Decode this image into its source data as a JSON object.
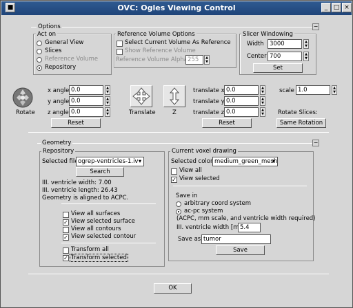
{
  "window": {
    "title": "OVC: Ogles Viewing Control"
  },
  "options": {
    "legend": "Options",
    "act_on": {
      "label": "Act on",
      "items": [
        "General View",
        "Slices",
        "Reference Volume",
        "Repository"
      ],
      "selected": "Repository"
    },
    "reference": {
      "legend": "Reference Volume Options",
      "select_current": "Select Current Volume As Reference",
      "show_reference": "Show Reference Volume",
      "alpha_label": "Reference Volume Alpha",
      "alpha_value": "255"
    },
    "slicer": {
      "legend": "Slicer Windowing",
      "width_label": "Width",
      "width_value": "3000",
      "center_label": "Center",
      "center_value": "700",
      "set_button": "Set"
    }
  },
  "transform": {
    "rotate_label": "Rotate",
    "x_angle_label": "x angle",
    "x_angle": "0.0",
    "y_angle_label": "y angle",
    "y_angle": "0.0",
    "z_angle_label": "z angle",
    "z_angle": "0.0",
    "reset_rotate": "Reset",
    "translate_label": "Translate",
    "z_label": "Z",
    "translate_x_label": "translate x",
    "translate_x": "0.0",
    "translate_y_label": "translate y",
    "translate_y": "0.0",
    "translate_z_label": "translate z",
    "translate_z": "0.0",
    "reset_translate": "Reset",
    "scale_label": "scale",
    "scale_value": "1.0",
    "rotate_slices_label": "Rotate Slices:",
    "same_rotation": "Same Rotation"
  },
  "geometry": {
    "legend": "Geometry",
    "repository": {
      "legend": "Repository",
      "selected_file_label": "Selected file",
      "selected_file": "ogrep-ventricles-1.iv",
      "search_button": "Search",
      "ventricle_width": "III. ventricle width:  7.00",
      "ventricle_length": "III. ventricle length: 26.43",
      "aligned": "Geometry is aligned to ACPC.",
      "checks": [
        {
          "label": "View all surfaces",
          "checked": false
        },
        {
          "label": "View selected surface",
          "checked": true
        },
        {
          "label": "View all contours",
          "checked": false
        },
        {
          "label": "View selected contour",
          "checked": true
        }
      ],
      "transform_all": "Transform all",
      "transform_selected": "Transform selected"
    },
    "voxel": {
      "legend": "Current voxel drawing",
      "selected_color_label": "Selected color",
      "selected_color": "medium_green_mesh",
      "view_all": "View all",
      "view_selected": "View selected",
      "save_in_label": "Save in",
      "arbitrary": "arbitrary coord system",
      "acpc": "ac-pc system",
      "acpc_note": "(ACPC, mm scale, and ventricle width required)",
      "width_label": "III. ventricle width [mm]",
      "width_value": "5.4",
      "save_as_label": "Save as",
      "save_as_value": "tumor",
      "save_button": "Save"
    }
  },
  "ok_button": "OK",
  "colors": {
    "title_bg": "#2f5a91",
    "panel_bg": "#d6d6d6"
  }
}
